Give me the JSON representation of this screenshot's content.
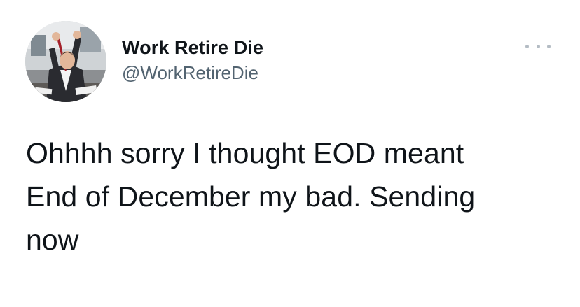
{
  "tweet": {
    "author": {
      "display_name": "Work Retire Die",
      "handle": "@WorkRetireDie",
      "avatar_icon": "avatar-photo-icon"
    },
    "more_icon": "more-options-icon",
    "text_lines": [
      "Ohhhh sorry I thought EOD meant",
      "End of December my bad. Sending",
      "now"
    ]
  },
  "colors": {
    "text_primary": "#0f1419",
    "text_secondary": "#536471",
    "icon_muted": "#b4bcc4",
    "background": "#ffffff"
  }
}
